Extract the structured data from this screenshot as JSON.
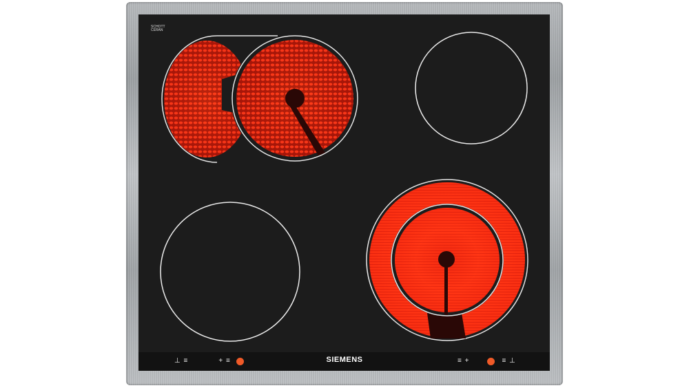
{
  "brand": "SIEMENS",
  "logo": {
    "line1": "SCHOTT",
    "line2": "CERAN",
    "small": ""
  },
  "controls": {
    "left_symbol_a": "⊥ ≡",
    "left_symbol_b": "+ ≡",
    "right_symbol_a": "≡ +",
    "right_symbol_b": "≡ ⊥"
  },
  "colors": {
    "glass": "#1c1c1c",
    "frame": "#aeb1b4",
    "heat": "#ff2a10",
    "indicator": "#f05a28"
  }
}
